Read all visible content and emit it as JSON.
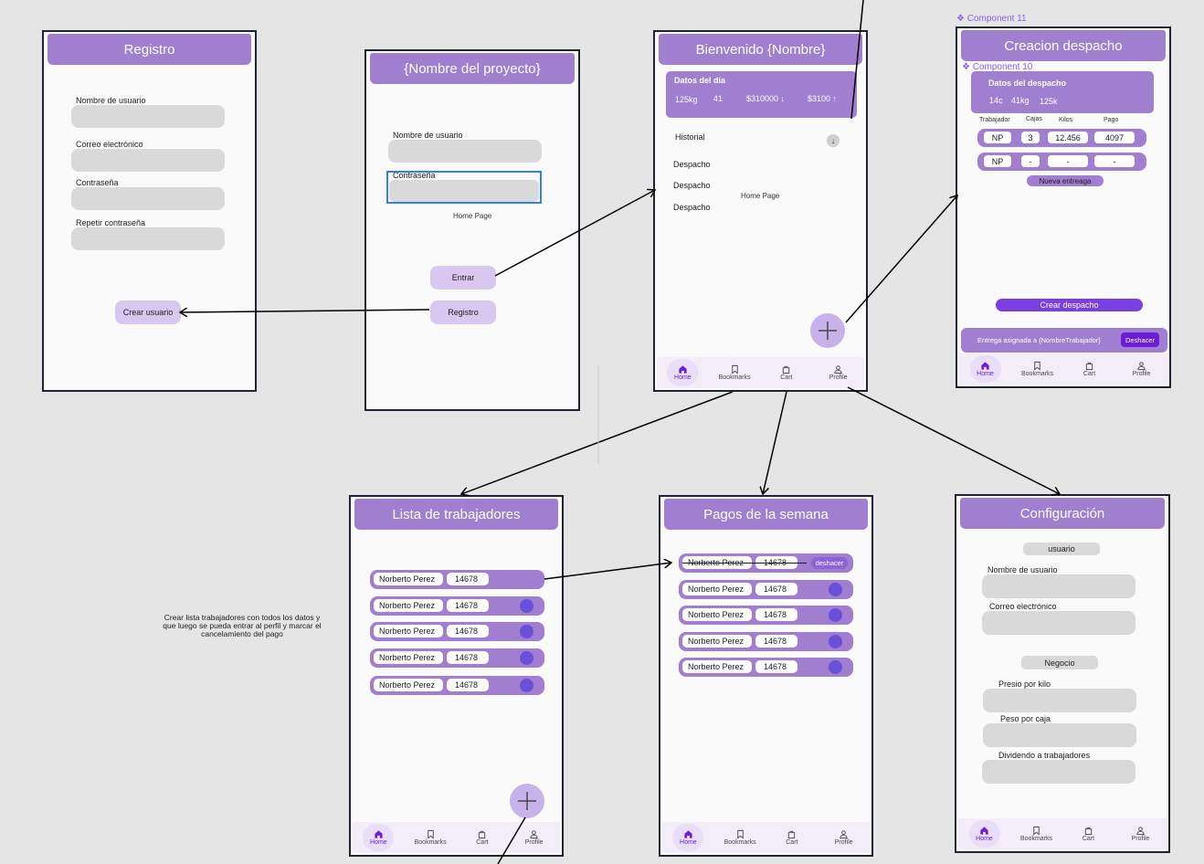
{
  "registro": {
    "title": "Registro",
    "labels": [
      "Nombre de usuario",
      "Correo electrónico",
      "Contraseña",
      "Repetir contraseña"
    ],
    "button": "Crear usuario"
  },
  "login": {
    "title": "{Nombre del proyecto}",
    "user_label": "Nombre de usuario",
    "pass_label": "Contraseña",
    "home_link": "Home Page",
    "enter_button": "Entrar",
    "register_button": "Registro"
  },
  "home": {
    "title": "Bienvenido {Nombre}",
    "card_title": "Datos del día",
    "stats": [
      "125kg",
      "41",
      "$310000 ↓",
      "$3100 ↑"
    ],
    "historial": "Historial",
    "historial_icon": "↓",
    "despachos": [
      "Despacho",
      "Despacho",
      "Despacho"
    ],
    "home_link": "Home Page"
  },
  "despacho": {
    "component11": "❖ Component 11",
    "component10": "❖ Component 10",
    "title": "Creacion despacho",
    "card_title": "Datos del despacho",
    "stats": [
      "14c",
      "41kg",
      "125k"
    ],
    "columns": [
      "Trabajador",
      "Cajas",
      "Kilos",
      "Pago"
    ],
    "rows": [
      [
        "NP",
        "3",
        "12.456",
        "4097"
      ],
      [
        "NP",
        "-",
        "-",
        "-"
      ]
    ],
    "new_button": "Nueva entreaga",
    "create_button": "Crear despacho",
    "snackbar": "Entrega asignada a {NombreTrabajador}",
    "undo": "Deshacer"
  },
  "trabajadores": {
    "title": "Lista de trabajadores",
    "rows": [
      {
        "name": "Norberto Perez",
        "value": "14678"
      },
      {
        "name": "Norberto Perez",
        "value": "14678"
      },
      {
        "name": "Norberto Perez",
        "value": "14678"
      },
      {
        "name": "Norberto Perez",
        "value": "14678"
      },
      {
        "name": "Norberto Perez",
        "value": "14678"
      }
    ]
  },
  "pagos": {
    "title": "Pagos de la semana",
    "undo": "deshacer",
    "rows": [
      {
        "name": "Norberto Perez",
        "value": "14678"
      },
      {
        "name": "Norberto Perez",
        "value": "14678"
      },
      {
        "name": "Norberto Perez",
        "value": "14678"
      },
      {
        "name": "Norberto Perez",
        "value": "14678"
      },
      {
        "name": "Norberto Perez",
        "value": "14678"
      }
    ]
  },
  "config": {
    "title": "Configuración",
    "section1": "usuario",
    "user_label": "Nombre de usuario",
    "email_label": "Correo electrónico",
    "section2": "Negocio",
    "kilo_label": "Presio por kilo",
    "caja_label": "Peso por caja",
    "div_label": "Dividendo a trabajadores"
  },
  "nav": {
    "home": "Home",
    "bookmarks": "Bookmarks",
    "cart": "Cart",
    "profile": "Profile"
  },
  "annotation": "Crear lista trabajadores con todos los datos y que luego se pueda entrar al perfil y marcar el cancelamiento del pago",
  "colors": {
    "header": "#a07ed0",
    "accent": "#6a1ed8",
    "canvas": "#e5e5e5"
  }
}
